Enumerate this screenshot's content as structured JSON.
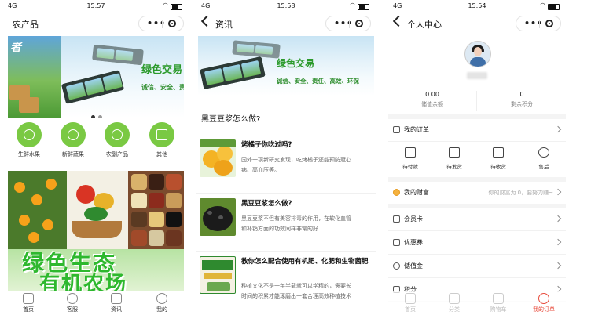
{
  "screen1": {
    "status": {
      "carrier": "4G",
      "time": "15:57"
    },
    "title": "农产品",
    "banner": {
      "title": "绿色交易",
      "subtitle": "诚信、安全、责",
      "left_char": "者"
    },
    "categories": [
      {
        "label": "生鲜水果",
        "icon": "apple-icon"
      },
      {
        "label": "新鲜蔬果",
        "icon": "vegetable-icon"
      },
      {
        "label": "农副产品",
        "icon": "farm-product-icon"
      },
      {
        "label": "其他",
        "icon": "gift-icon"
      }
    ],
    "promo": {
      "line1": "绿色生态",
      "line2": "有机农场"
    },
    "tabbar": [
      {
        "label": "首页",
        "icon": "home-icon"
      },
      {
        "label": "客服",
        "icon": "service-icon"
      },
      {
        "label": "资讯",
        "icon": "news-icon"
      },
      {
        "label": "我的",
        "icon": "user-icon"
      }
    ]
  },
  "screen2": {
    "status": {
      "carrier": "4G",
      "time": "15:58"
    },
    "title": "资讯",
    "banner": {
      "title": "绿色交易",
      "subtitle": "诚信、安全、责任、高效、环保"
    },
    "heading": "黑豆豆浆怎么做?",
    "articles": [
      {
        "title": "烤橘子你吃过吗?",
        "desc1": "国外一项新研究发现，吃烤橘子还能预防冠心",
        "desc2": "病、高血压等。"
      },
      {
        "title": "黑豆豆浆怎么做?",
        "desc1": "黑豆豆浆不但有美容排毒的作用，在软化血管",
        "desc2": "和补钙方面的功效同样非常的好"
      },
      {
        "title": "教你怎么配合使用有机肥、化肥和生物菌肥",
        "desc1": "种植文化不是一年半载就可以学精的，需要长",
        "desc2": "时间的积累才能琢磨出一套合理高效种植技术"
      }
    ]
  },
  "screen3": {
    "status": {
      "carrier": "4G",
      "time": "15:54"
    },
    "title": "个人中心",
    "stats": [
      {
        "value": "0.00",
        "label": "储值余额"
      },
      {
        "value": "0",
        "label": "剩余积分"
      }
    ],
    "orders_label": "我的订单",
    "order_states": [
      {
        "label": "待付款",
        "icon": "wallet-icon"
      },
      {
        "label": "待发货",
        "icon": "package-icon"
      },
      {
        "label": "待收货",
        "icon": "truck-icon"
      },
      {
        "label": "售后",
        "icon": "yen-icon"
      }
    ],
    "wealth": {
      "label": "我的财富",
      "hint": "你的财富为 0，要努力赚~"
    },
    "menu": [
      {
        "label": "会员卡",
        "icon": "card-icon"
      },
      {
        "label": "优惠券",
        "icon": "coupon-icon"
      },
      {
        "label": "储值金",
        "icon": "coins-icon"
      },
      {
        "label": "积分",
        "icon": "points-icon"
      }
    ],
    "tabbar_faded": [
      {
        "label": "首页",
        "icon": "home-icon"
      },
      {
        "label": "分类",
        "icon": "category-icon"
      },
      {
        "label": "购物车",
        "icon": "cart-icon"
      }
    ],
    "tab_active": {
      "label": "我的订单",
      "icon": "user-icon"
    }
  }
}
